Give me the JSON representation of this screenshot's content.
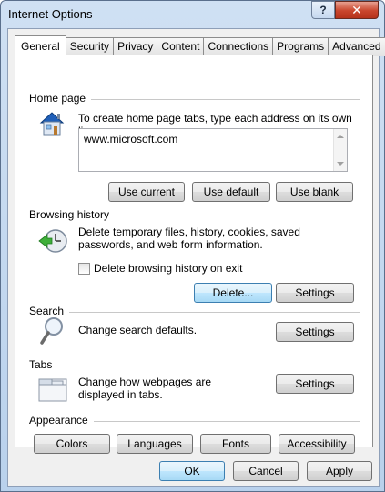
{
  "window": {
    "title": "Internet Options",
    "help_label": "?",
    "close_label": "✕"
  },
  "tabs": [
    {
      "label": "General",
      "active": true
    },
    {
      "label": "Security"
    },
    {
      "label": "Privacy"
    },
    {
      "label": "Content"
    },
    {
      "label": "Connections"
    },
    {
      "label": "Programs"
    },
    {
      "label": "Advanced"
    }
  ],
  "home_page": {
    "heading": "Home page",
    "description": "To create home page tabs, type each address on its own line.",
    "url_value": "www.microsoft.com",
    "use_current_label": "Use current",
    "use_default_label": "Use default",
    "use_blank_label": "Use blank"
  },
  "browsing_history": {
    "heading": "Browsing history",
    "description": "Delete temporary files, history, cookies, saved passwords, and web form information.",
    "checkbox_label": "Delete browsing history on exit",
    "checked": false,
    "delete_label": "Delete...",
    "settings_label": "Settings"
  },
  "search": {
    "heading": "Search",
    "description": "Change search defaults.",
    "settings_label": "Settings"
  },
  "tabs_section": {
    "heading": "Tabs",
    "description": "Change how webpages are displayed in tabs.",
    "settings_label": "Settings"
  },
  "appearance": {
    "heading": "Appearance",
    "colors_label": "Colors",
    "languages_label": "Languages",
    "fonts_label": "Fonts",
    "accessibility_label": "Accessibility"
  },
  "footer": {
    "ok_label": "OK",
    "cancel_label": "Cancel",
    "apply_label": "Apply"
  }
}
